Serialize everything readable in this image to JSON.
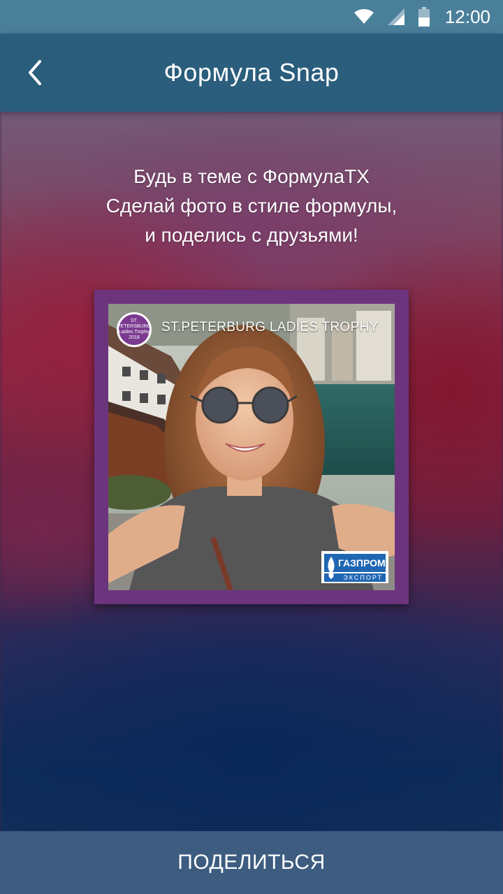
{
  "status_bar": {
    "time": "12:00",
    "icons": [
      "wifi-icon",
      "signal-icon",
      "battery-icon"
    ]
  },
  "app_bar": {
    "title": "Формула Snap",
    "back_icon": "chevron-left-icon"
  },
  "intro": {
    "lines": [
      "Будь в теме с ФормулаТХ",
      "Сделай фото в стиле формулы,",
      "и поделись с друзьями!"
    ]
  },
  "photo_card": {
    "event_title": "ST.PETERBURG LADIES TROPHY",
    "trophy_logo_text": "ST. PETERSBURG Ladies Trophy 2018",
    "sponsor_top": "ГАЗПРОМ",
    "sponsor_bottom": "ЭКСПОРТ",
    "frame_color": "#6d347e"
  },
  "share": {
    "label": "ПОДЕЛИТЬСЯ"
  },
  "colors": {
    "status_bar": "#4a7f9a",
    "app_bar": "#2b5d7c",
    "share_bar": "#3d5c80"
  }
}
